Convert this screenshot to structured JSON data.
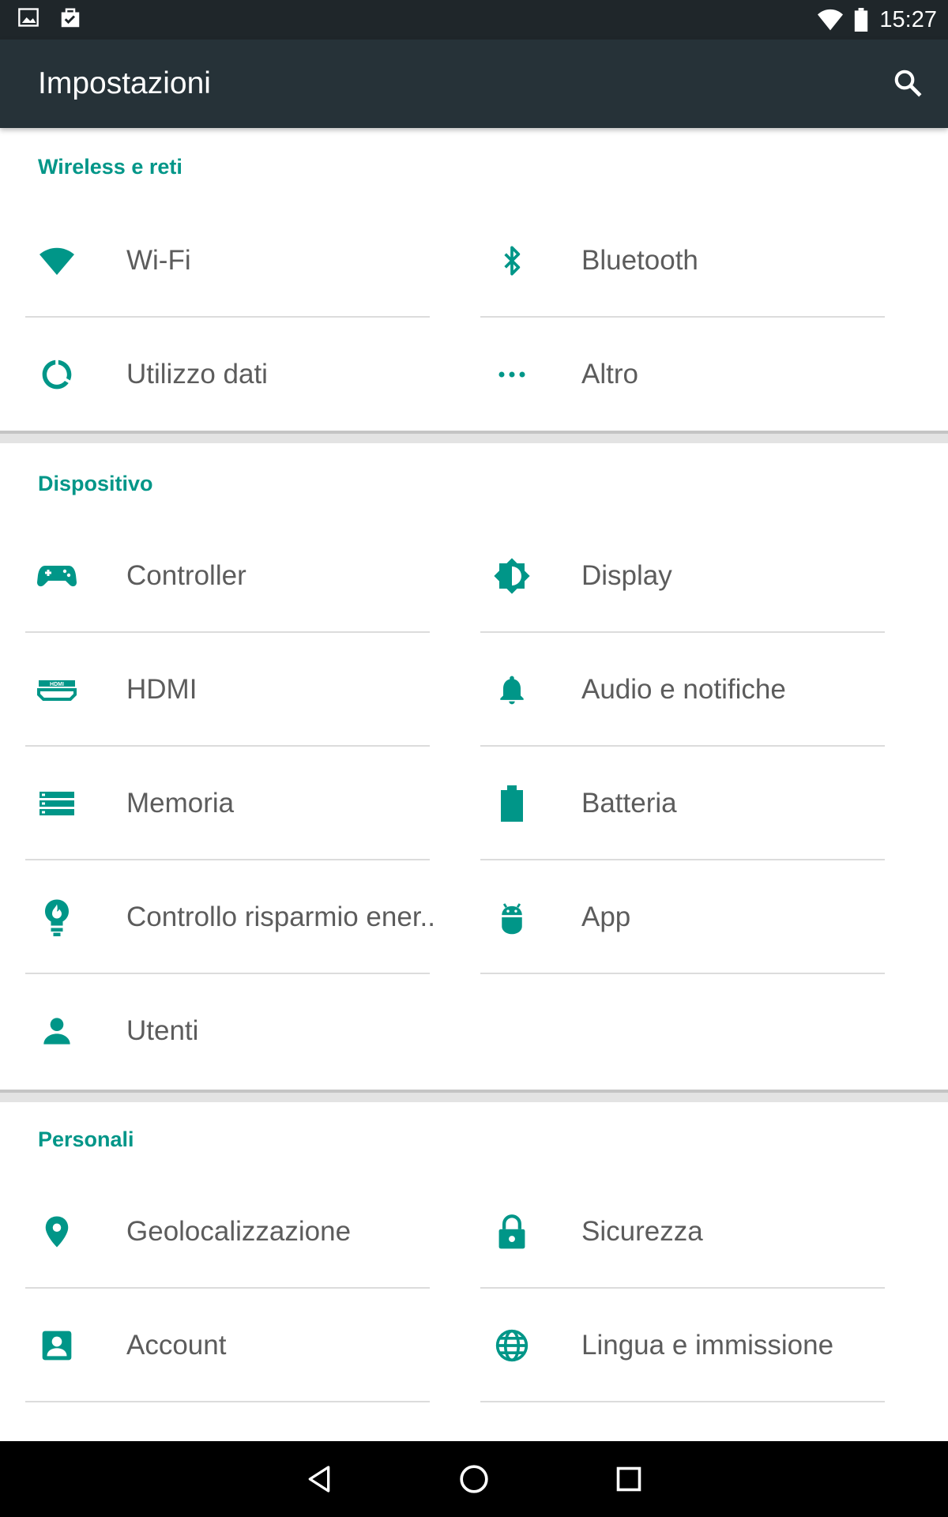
{
  "status_bar": {
    "time": "15:27",
    "icons": [
      "image-notification-icon",
      "task-notification-icon",
      "wifi-icon",
      "battery-icon"
    ]
  },
  "app_bar": {
    "title": "Impostazioni",
    "search_icon": "search-icon"
  },
  "sections": [
    {
      "title": "Wireless e reti",
      "items": [
        {
          "label": "Wi-Fi",
          "icon": "wifi-icon"
        },
        {
          "label": "Bluetooth",
          "icon": "bluetooth-icon"
        },
        {
          "label": "Utilizzo dati",
          "icon": "data-usage-icon"
        },
        {
          "label": "Altro",
          "icon": "more-icon"
        }
      ]
    },
    {
      "title": "Dispositivo",
      "items": [
        {
          "label": "Controller",
          "icon": "gamepad-icon"
        },
        {
          "label": "Display",
          "icon": "brightness-icon"
        },
        {
          "label": "HDMI",
          "icon": "hdmi-icon"
        },
        {
          "label": "Audio e notifiche",
          "icon": "bell-icon"
        },
        {
          "label": "Memoria",
          "icon": "storage-icon"
        },
        {
          "label": "Batteria",
          "icon": "battery-icon"
        },
        {
          "label": "Controllo risparmio ener..",
          "icon": "power-saving-bulb-icon"
        },
        {
          "label": "App",
          "icon": "android-icon"
        },
        {
          "label": "Utenti",
          "icon": "person-icon"
        }
      ]
    },
    {
      "title": "Personali",
      "items": [
        {
          "label": "Geolocalizzazione",
          "icon": "location-pin-icon"
        },
        {
          "label": "Sicurezza",
          "icon": "lock-icon"
        },
        {
          "label": "Account",
          "icon": "account-box-icon"
        },
        {
          "label": "Lingua e immissione",
          "icon": "globe-icon"
        }
      ]
    }
  ],
  "nav_bar": {
    "icons": [
      "back-icon",
      "home-icon",
      "recents-icon"
    ]
  },
  "colors": {
    "accent": "#009688",
    "app_bar": "#263238",
    "status_bar": "#1f262a",
    "text": "#5c5c5c"
  }
}
